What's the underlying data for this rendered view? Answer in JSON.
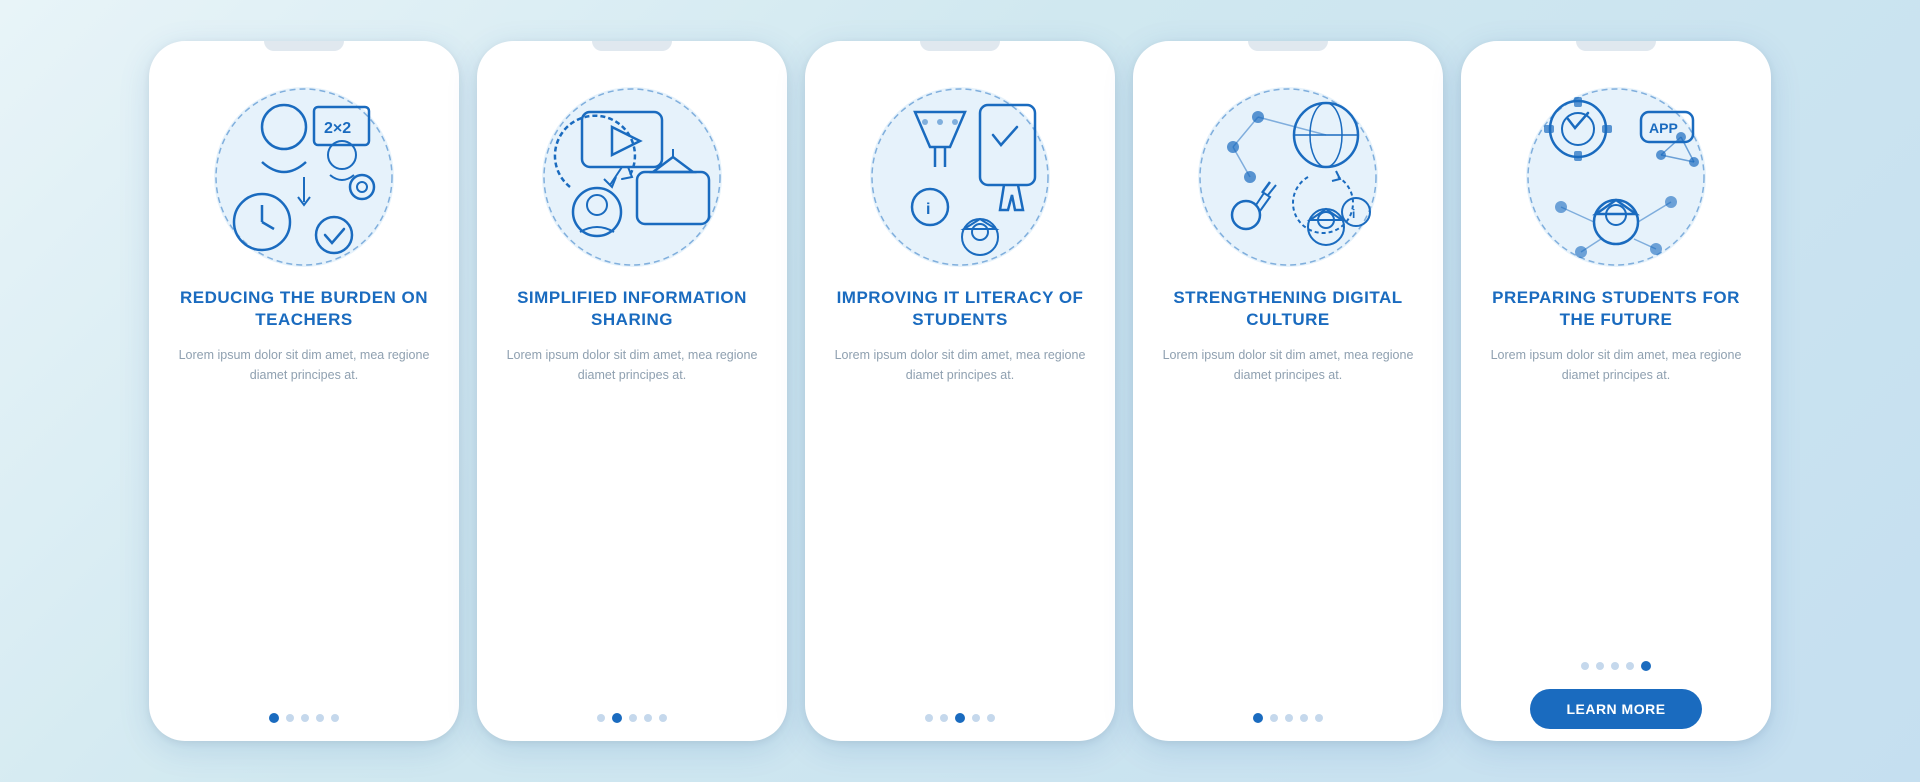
{
  "background": {
    "color_start": "#e8f4f8",
    "color_end": "#c5dff0"
  },
  "cards": [
    {
      "id": "card-1",
      "title": "REDUCING THE BURDEN ON TEACHERS",
      "body": "Lorem ipsum dolor sit dim amet, mea regione diamet principes at.",
      "dots": [
        "inactive",
        "inactive",
        "inactive",
        "inactive",
        "inactive"
      ],
      "active_dot": 0,
      "show_button": false,
      "button_label": ""
    },
    {
      "id": "card-2",
      "title": "SIMPLIFIED INFORMATION SHARING",
      "body": "Lorem ipsum dolor sit dim amet, mea regione diamet principes at.",
      "dots": [
        "inactive",
        "active",
        "inactive",
        "inactive",
        "inactive"
      ],
      "active_dot": 1,
      "show_button": false,
      "button_label": ""
    },
    {
      "id": "card-3",
      "title": "IMPROVING IT LITERACY OF STUDENTS",
      "body": "Lorem ipsum dolor sit dim amet, mea regione diamet principes at.",
      "dots": [
        "inactive",
        "inactive",
        "active",
        "inactive",
        "inactive"
      ],
      "active_dot": 2,
      "show_button": false,
      "button_label": ""
    },
    {
      "id": "card-4",
      "title": "STRENGTHENING DIGITAL CULTURE",
      "body": "Lorem ipsum dolor sit dim amet, mea regione diamet principes at.",
      "dots": [
        "inactive",
        "inactive",
        "inactive",
        "inactive",
        "inactive"
      ],
      "active_dot": 0,
      "show_button": false,
      "button_label": ""
    },
    {
      "id": "card-5",
      "title": "PREPARING STUDENTS FOR THE FUTURE",
      "body": "Lorem ipsum dolor sit dim amet, mea regione diamet principes at.",
      "dots": [
        "inactive",
        "inactive",
        "inactive",
        "inactive",
        "active"
      ],
      "active_dot": 4,
      "show_button": true,
      "button_label": "LEARN MORE"
    }
  ],
  "accent_color": "#1a6bbf",
  "dot_inactive_color": "#c5d8ec",
  "dot_active_color": "#1a6bbf"
}
